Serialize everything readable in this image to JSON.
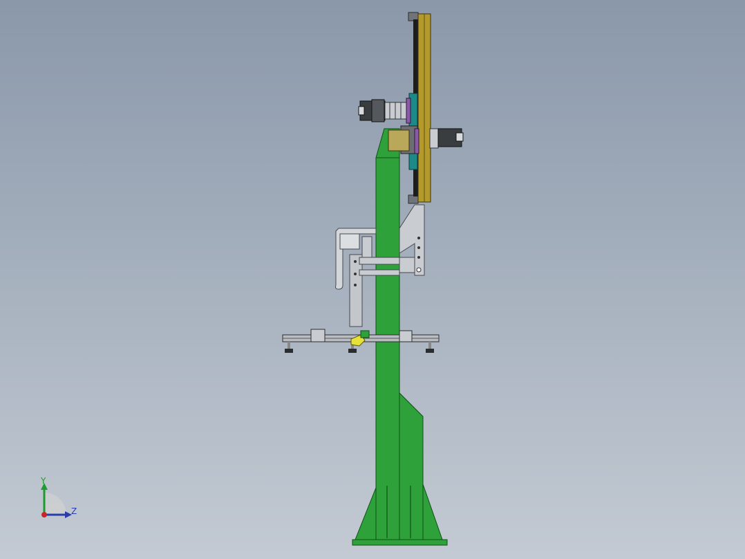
{
  "viewport": {
    "background_top": "#8a98aa",
    "background_bottom": "#c3cad3"
  },
  "triad": {
    "y_label": "Y",
    "z_label": "Z",
    "y_color": "#1f9a2e",
    "z_color": "#2a3da8",
    "x_color": "#c62828"
  },
  "model": {
    "frame_color": "#2fa13a",
    "frame_edge": "#0f4f16",
    "rail_color": "#b49a2a",
    "steel_color": "#c9ccd0",
    "motor_color": "#3a3d40"
  }
}
